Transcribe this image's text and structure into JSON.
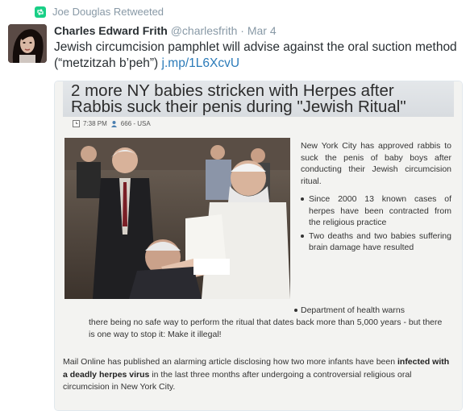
{
  "retweet": {
    "label": "Joe Douglas Retweeted"
  },
  "author": {
    "name": "Charles Edward Frith",
    "handle": "@charlesfrith",
    "date": "Mar 4",
    "separator": "·"
  },
  "tweet": {
    "text": "Jewish circumcision pamphlet will advise against the oral suction method (“metzitzah b’peh”)",
    "link": "j.mp/1L6XcvU"
  },
  "article": {
    "headline": "2 more NY babies stricken with Herpes after Rabbis suck their penis during \"Jewish Ritual\"",
    "meta_time": "7:38 PM",
    "meta_views": "666 - USA",
    "intro": "New York City has approved rabbis to suck the penis of baby boys after conducting their Jewish circumcision ritual.",
    "bullets": [
      "Since 2000 13 known cases of herpes have been contracted from the religious practice",
      "Two deaths and two babies suffering brain damage have resulted"
    ],
    "bullet3_lead": "Department of health warns",
    "bullet3_rest": "there being no safe way to perform the ritual that dates back more than 5,000 years - but there is one way to stop it: Make it illegal!",
    "para_a": "Mail Online has published an alarming article disclosing how two more infants have been ",
    "para_bold": "infected with a deadly herpes virus",
    "para_b": " in the last three months after undergoing a controversial religious oral circumcision in New York City."
  },
  "colors": {
    "retweet_green": "#19cf86",
    "link_blue": "#2b7bb9",
    "muted": "#8899a6",
    "text": "#292f33"
  },
  "icons": [
    "retweet-icon",
    "clock-icon",
    "user-icon"
  ]
}
